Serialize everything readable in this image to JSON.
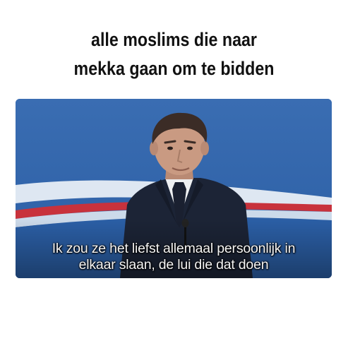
{
  "meme": {
    "caption_lines": [
      "alle moslims die naar",
      "mekka gaan om te bidden"
    ],
    "subtitle_lines": [
      "Ik zou ze het liefst allemaal persoonlijk in",
      "elkaar slaan, de lui die dat doen"
    ]
  },
  "colors": {
    "backdrop_blue": "#2d63aa",
    "stripe_red": "#c8323c",
    "stripe_white": "#e8eef6",
    "suit": "#1c2436",
    "shirt": "#eef0f2",
    "tie": "#1a2030",
    "skin": "#c99a82",
    "hair": "#3b2c26"
  },
  "icons": {
    "microphone": "microphone-icon"
  }
}
